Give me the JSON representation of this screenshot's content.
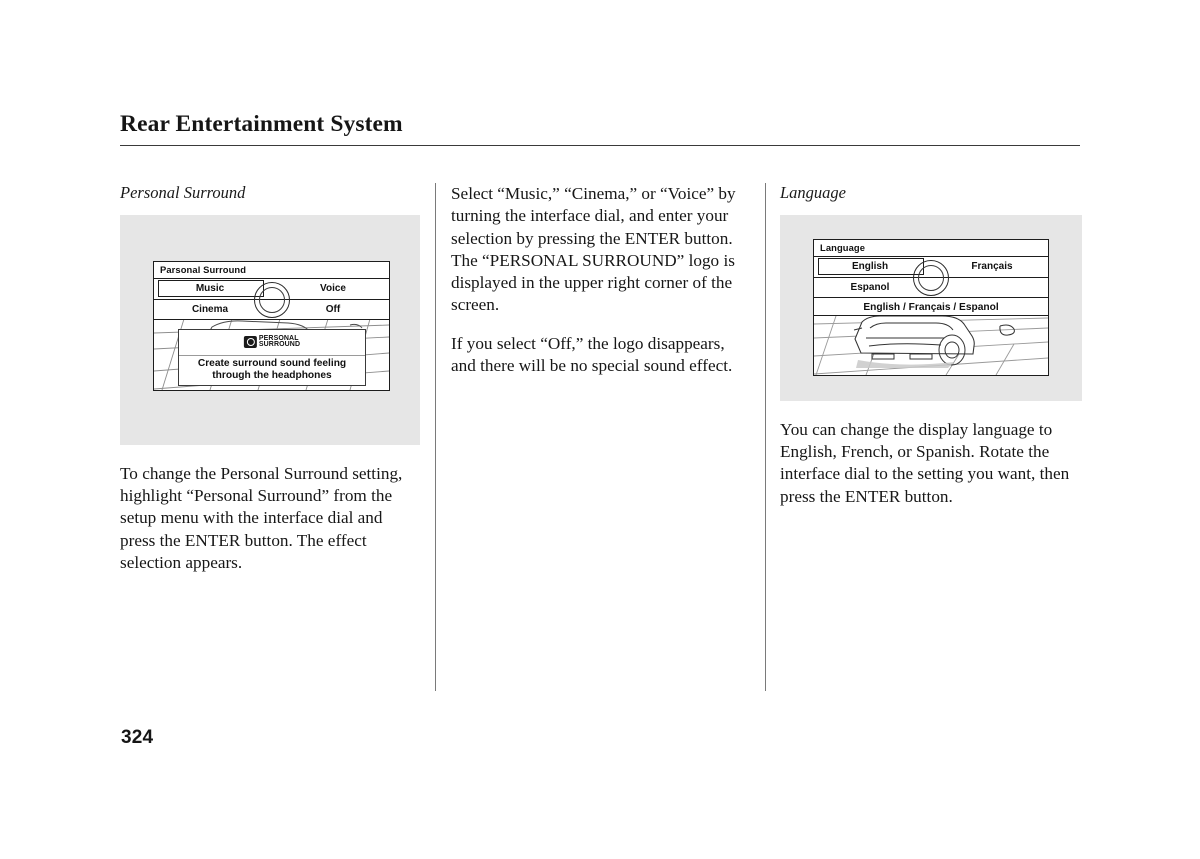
{
  "document": {
    "section_title": "Rear Entertainment System",
    "page_number": "324"
  },
  "columns": {
    "left": {
      "heading": "Personal Surround",
      "figure": {
        "screen_title": "Parsonal Surround",
        "menu": {
          "items": [
            {
              "label": "Music",
              "selected": true
            },
            {
              "label": "Voice",
              "selected": false
            },
            {
              "label": "Cinema",
              "selected": false
            },
            {
              "label": "Off",
              "selected": false
            }
          ]
        },
        "popup": {
          "logo_line1": "PERSONAL",
          "logo_line2": "SURROUND",
          "message_line1": "Create surround sound feeling",
          "message_line2": "through the headphones"
        }
      },
      "body": "To change the Personal Surround setting, highlight “Personal Surround” from the setup menu with the interface dial and press the ENTER button. The effect selection appears."
    },
    "middle": {
      "paragraph_1": "Select “Music,” “Cinema,” or “Voice” by turning the interface dial, and enter your selection by pressing the ENTER button. The “PERSONAL SURROUND” logo is displayed in the upper right corner of the screen.",
      "paragraph_2": "If you select “Off,” the logo disappears, and there will be no special sound effect."
    },
    "right": {
      "heading": "Language",
      "figure": {
        "screen_title": "Language",
        "menu": {
          "items": [
            {
              "label": "English",
              "selected": true
            },
            {
              "label": "Français",
              "selected": false
            },
            {
              "label": "Espanol",
              "selected": false
            }
          ]
        },
        "caption_line": "English / Français / Espanol"
      },
      "body": "You can change the display language to English, French, or Spanish. Rotate the interface dial to the setting you want, then press the ENTER button."
    }
  },
  "icons": {
    "interface_dial": "dial-icon",
    "personal_surround_logo": "personal-surround-logo-icon",
    "vehicle_artwork": "vehicle-rear-view-icon"
  },
  "colors": {
    "page_background": "#ffffff",
    "figure_background": "#e6e6e6",
    "text": "#171717",
    "rule": "#3a3a3a"
  }
}
